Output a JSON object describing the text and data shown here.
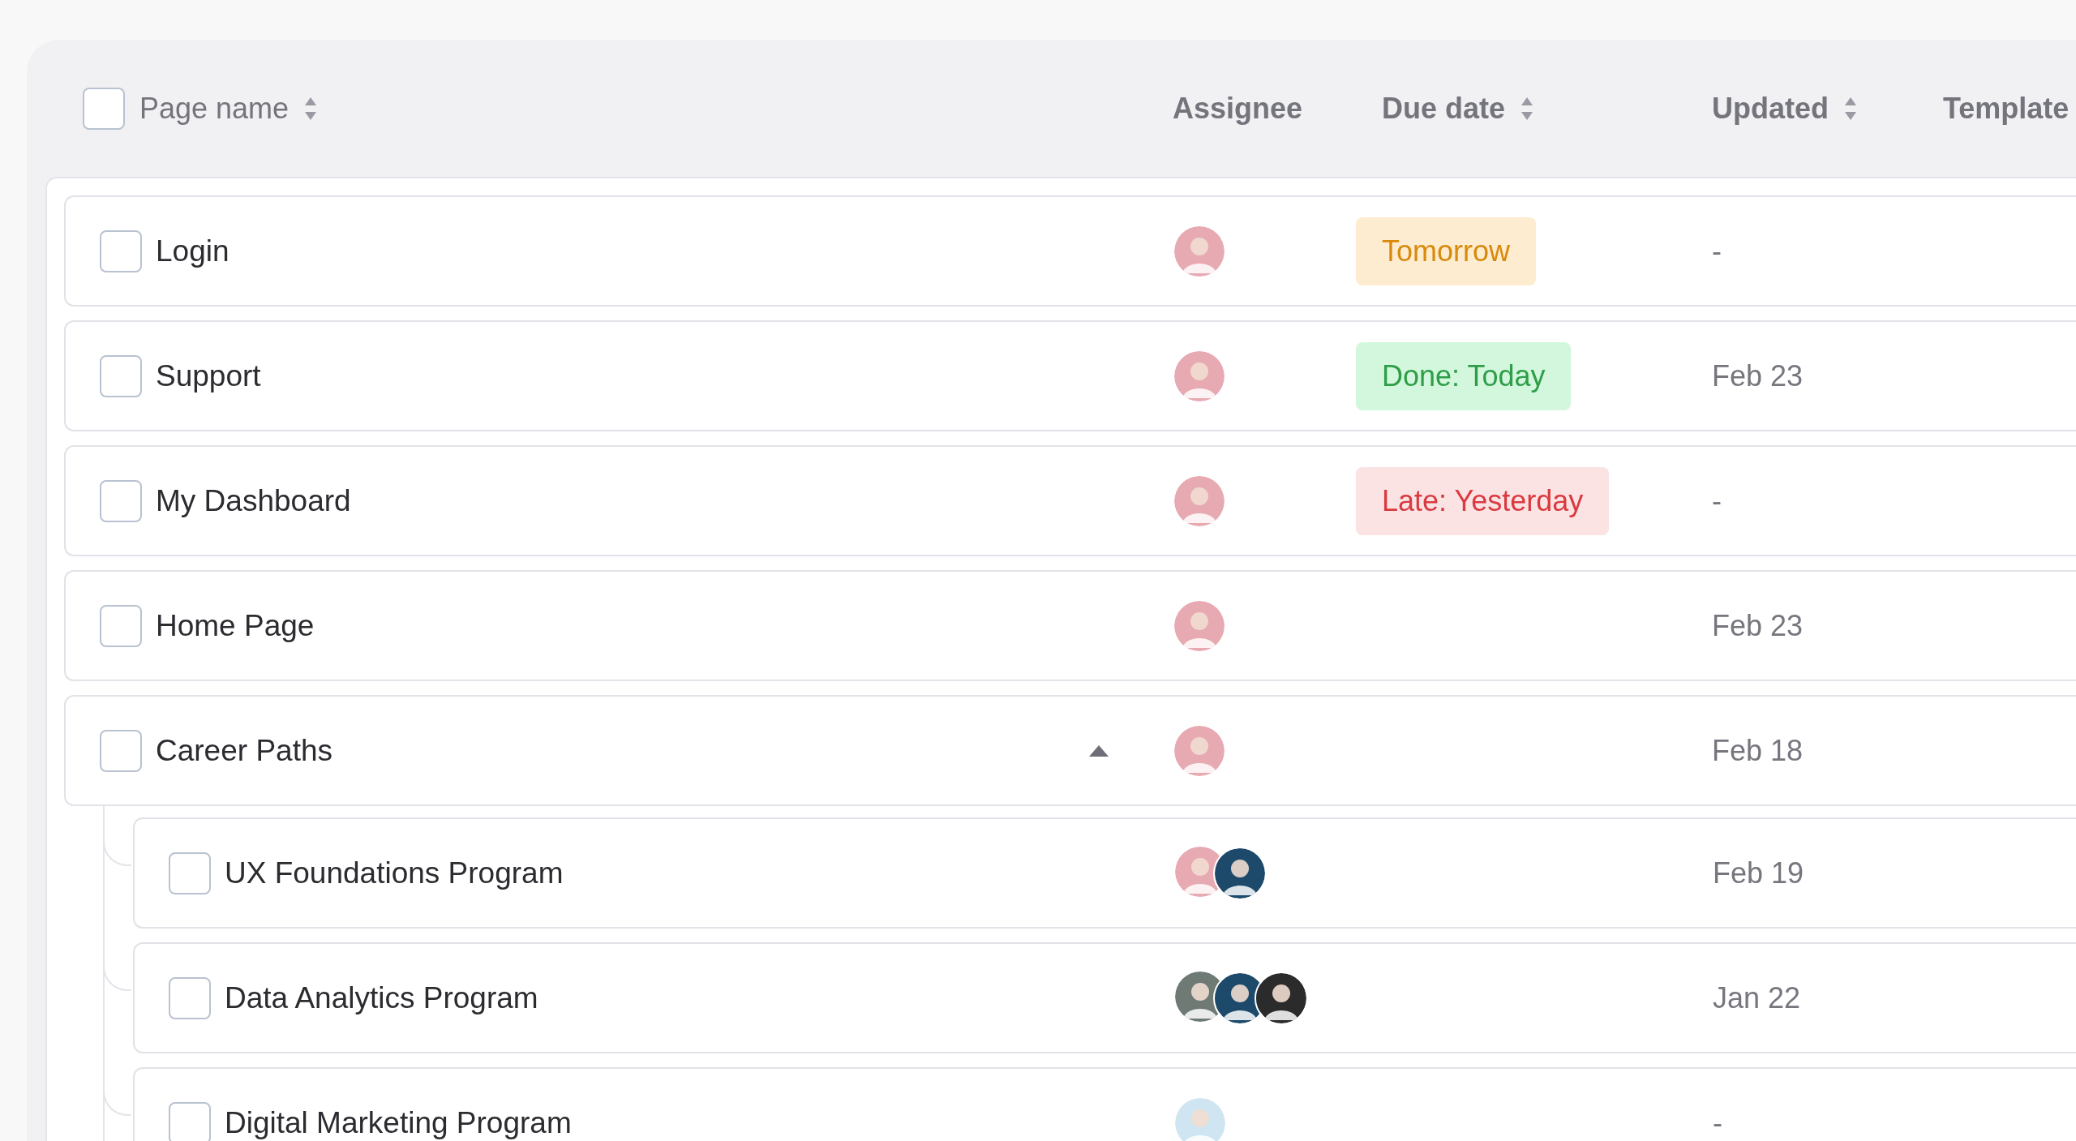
{
  "header": {
    "checked": false,
    "columns": [
      {
        "label": "Page name",
        "sortable": true
      },
      {
        "label": "Assignee",
        "sortable": false
      },
      {
        "label": "Due date",
        "sortable": true
      },
      {
        "label": "Updated",
        "sortable": true
      },
      {
        "label": "Template",
        "sortable": false
      }
    ]
  },
  "rows": [
    {
      "name": "Login",
      "checked": false,
      "assignees": [
        {
          "color": "#e8aab2"
        }
      ],
      "due": {
        "text": "Tomorrow",
        "kind": "upcoming"
      },
      "updated": "-"
    },
    {
      "name": "Support",
      "checked": false,
      "assignees": [
        {
          "color": "#e8aab2"
        }
      ],
      "due": {
        "text": "Done: Today",
        "kind": "done"
      },
      "updated": "Feb 23"
    },
    {
      "name": "My Dashboard",
      "checked": false,
      "assignees": [
        {
          "color": "#e8aab2"
        }
      ],
      "due": {
        "text": "Late: Yesterday",
        "kind": "late"
      },
      "updated": "-"
    },
    {
      "name": "Home Page",
      "checked": false,
      "assignees": [
        {
          "color": "#e8aab2"
        }
      ],
      "updated": "Feb 23"
    },
    {
      "name": "Career Paths",
      "checked": false,
      "expanded": true,
      "assignees": [
        {
          "color": "#e8aab2"
        }
      ],
      "updated": "Feb 18",
      "children": [
        {
          "name": "UX Foundations Program",
          "checked": false,
          "assignees": [
            {
              "color": "#e8aab2"
            },
            {
              "color": "#1d4a6b"
            }
          ],
          "updated": "Feb 19"
        },
        {
          "name": "Data Analytics Program",
          "checked": false,
          "assignees": [
            {
              "color": "#6f7a74"
            },
            {
              "color": "#1d4a6b"
            },
            {
              "color": "#2b2b2b"
            }
          ],
          "updated": "Jan 22"
        },
        {
          "name": "Digital Marketing Program",
          "checked": false,
          "assignees": [
            {
              "color": "#cfe6f2"
            }
          ],
          "updated": "-"
        }
      ]
    }
  ]
}
